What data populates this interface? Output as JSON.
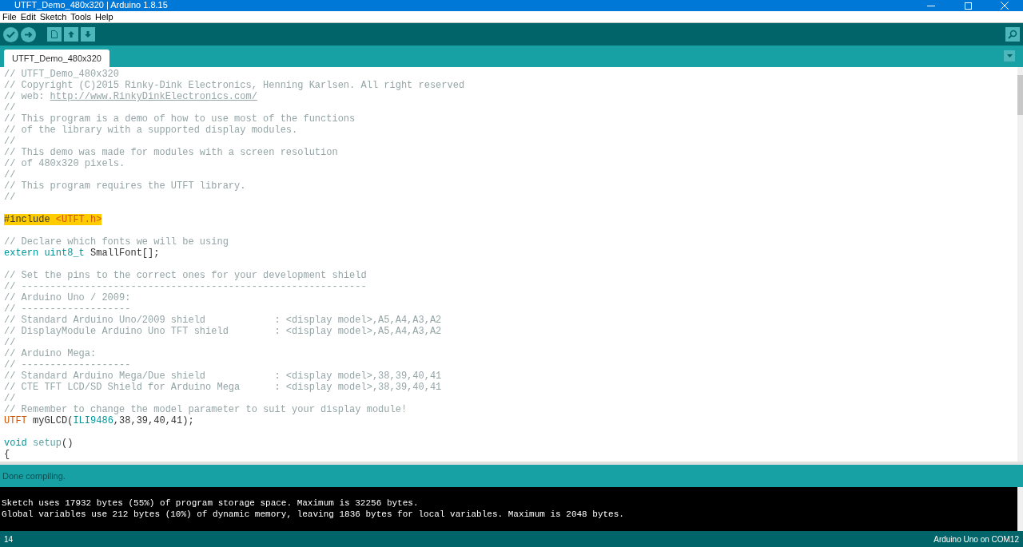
{
  "window": {
    "title": "UTFT_Demo_480x320 | Arduino 1.8.15"
  },
  "menu": [
    "File",
    "Edit",
    "Sketch",
    "Tools",
    "Help"
  ],
  "tabs": [
    {
      "label": "UTFT_Demo_480x320",
      "selected": true
    }
  ],
  "editor": {
    "lines": [
      {
        "segments": [
          {
            "kind": "comment",
            "text": "// UTFT_Demo_480x320"
          }
        ]
      },
      {
        "segments": [
          {
            "kind": "comment",
            "text": "// Copyright (C)2015 Rinky-Dink Electronics, Henning Karlsen. All right reserved"
          }
        ]
      },
      {
        "segments": [
          {
            "kind": "comment",
            "text": "// web: "
          },
          {
            "kind": "link",
            "text": "http://www.RinkyDinkElectronics.com/"
          }
        ]
      },
      {
        "segments": [
          {
            "kind": "comment",
            "text": "//"
          }
        ]
      },
      {
        "segments": [
          {
            "kind": "comment",
            "text": "// This program is a demo of how to use most of the functions"
          }
        ]
      },
      {
        "segments": [
          {
            "kind": "comment",
            "text": "// of the library with a supported display modules."
          }
        ]
      },
      {
        "segments": [
          {
            "kind": "comment",
            "text": "//"
          }
        ]
      },
      {
        "segments": [
          {
            "kind": "comment",
            "text": "// This demo was made for modules with a screen resolution"
          }
        ]
      },
      {
        "segments": [
          {
            "kind": "comment",
            "text": "// of 480x320 pixels."
          }
        ]
      },
      {
        "segments": [
          {
            "kind": "comment",
            "text": "//"
          }
        ]
      },
      {
        "segments": [
          {
            "kind": "comment",
            "text": "// This program requires the UTFT library."
          }
        ]
      },
      {
        "segments": [
          {
            "kind": "comment",
            "text": "//"
          }
        ]
      },
      {
        "blank": true
      },
      {
        "highlighted": true,
        "segments": [
          {
            "kind": "plain",
            "text": "#include "
          },
          {
            "kind": "library",
            "text": "<UTFT.h>"
          }
        ]
      },
      {
        "blank": true
      },
      {
        "segments": [
          {
            "kind": "comment",
            "text": "// Declare which fonts we will be using"
          }
        ]
      },
      {
        "segments": [
          {
            "kind": "keyword",
            "text": "extern uint8_t"
          },
          {
            "kind": "plain",
            "text": " SmallFont[];"
          }
        ]
      },
      {
        "blank": true
      },
      {
        "segments": [
          {
            "kind": "comment",
            "text": "// Set the pins to the correct ones for your development shield"
          }
        ]
      },
      {
        "segments": [
          {
            "kind": "comment",
            "text": "// ------------------------------------------------------------"
          }
        ]
      },
      {
        "segments": [
          {
            "kind": "comment",
            "text": "// Arduino Uno / 2009:"
          }
        ]
      },
      {
        "segments": [
          {
            "kind": "comment",
            "text": "// -------------------"
          }
        ]
      },
      {
        "segments": [
          {
            "kind": "comment",
            "text": "// Standard Arduino Uno/2009 shield            : <display model>,A5,A4,A3,A2"
          }
        ]
      },
      {
        "segments": [
          {
            "kind": "comment",
            "text": "// DisplayModule Arduino Uno TFT shield        : <display model>,A5,A4,A3,A2"
          }
        ]
      },
      {
        "segments": [
          {
            "kind": "comment",
            "text": "//"
          }
        ]
      },
      {
        "segments": [
          {
            "kind": "comment",
            "text": "// Arduino Mega:"
          }
        ]
      },
      {
        "segments": [
          {
            "kind": "comment",
            "text": "// -------------------"
          }
        ]
      },
      {
        "segments": [
          {
            "kind": "comment",
            "text": "// Standard Arduino Mega/Due shield            : <display model>,38,39,40,41"
          }
        ]
      },
      {
        "segments": [
          {
            "kind": "comment",
            "text": "// CTE TFT LCD/SD Shield for Arduino Mega      : <display model>,38,39,40,41"
          }
        ]
      },
      {
        "segments": [
          {
            "kind": "comment",
            "text": "//"
          }
        ]
      },
      {
        "segments": [
          {
            "kind": "comment",
            "text": "// Remember to change the model parameter to suit your display module!"
          }
        ]
      },
      {
        "segments": [
          {
            "kind": "library",
            "text": "UTFT"
          },
          {
            "kind": "plain",
            "text": " myGLCD("
          },
          {
            "kind": "keyword",
            "text": "ILI9486"
          },
          {
            "kind": "plain",
            "text": ",38,39,40,41);"
          }
        ]
      },
      {
        "blank": true
      },
      {
        "segments": [
          {
            "kind": "keyword",
            "text": "void "
          },
          {
            "kind": "function",
            "text": "setup"
          },
          {
            "kind": "plain",
            "text": "()"
          }
        ]
      },
      {
        "segments": [
          {
            "kind": "plain",
            "text": "{"
          }
        ]
      }
    ]
  },
  "status": "Done compiling.",
  "console": [
    "Sketch uses 17932 bytes (55%) of program storage space. Maximum is 32256 bytes.",
    "Global variables use 212 bytes (10%) of dynamic memory, leaving 1836 bytes for local variables. Maximum is 2048 bytes."
  ],
  "footer": {
    "line": "14",
    "board": "Arduino Uno on COM12"
  }
}
